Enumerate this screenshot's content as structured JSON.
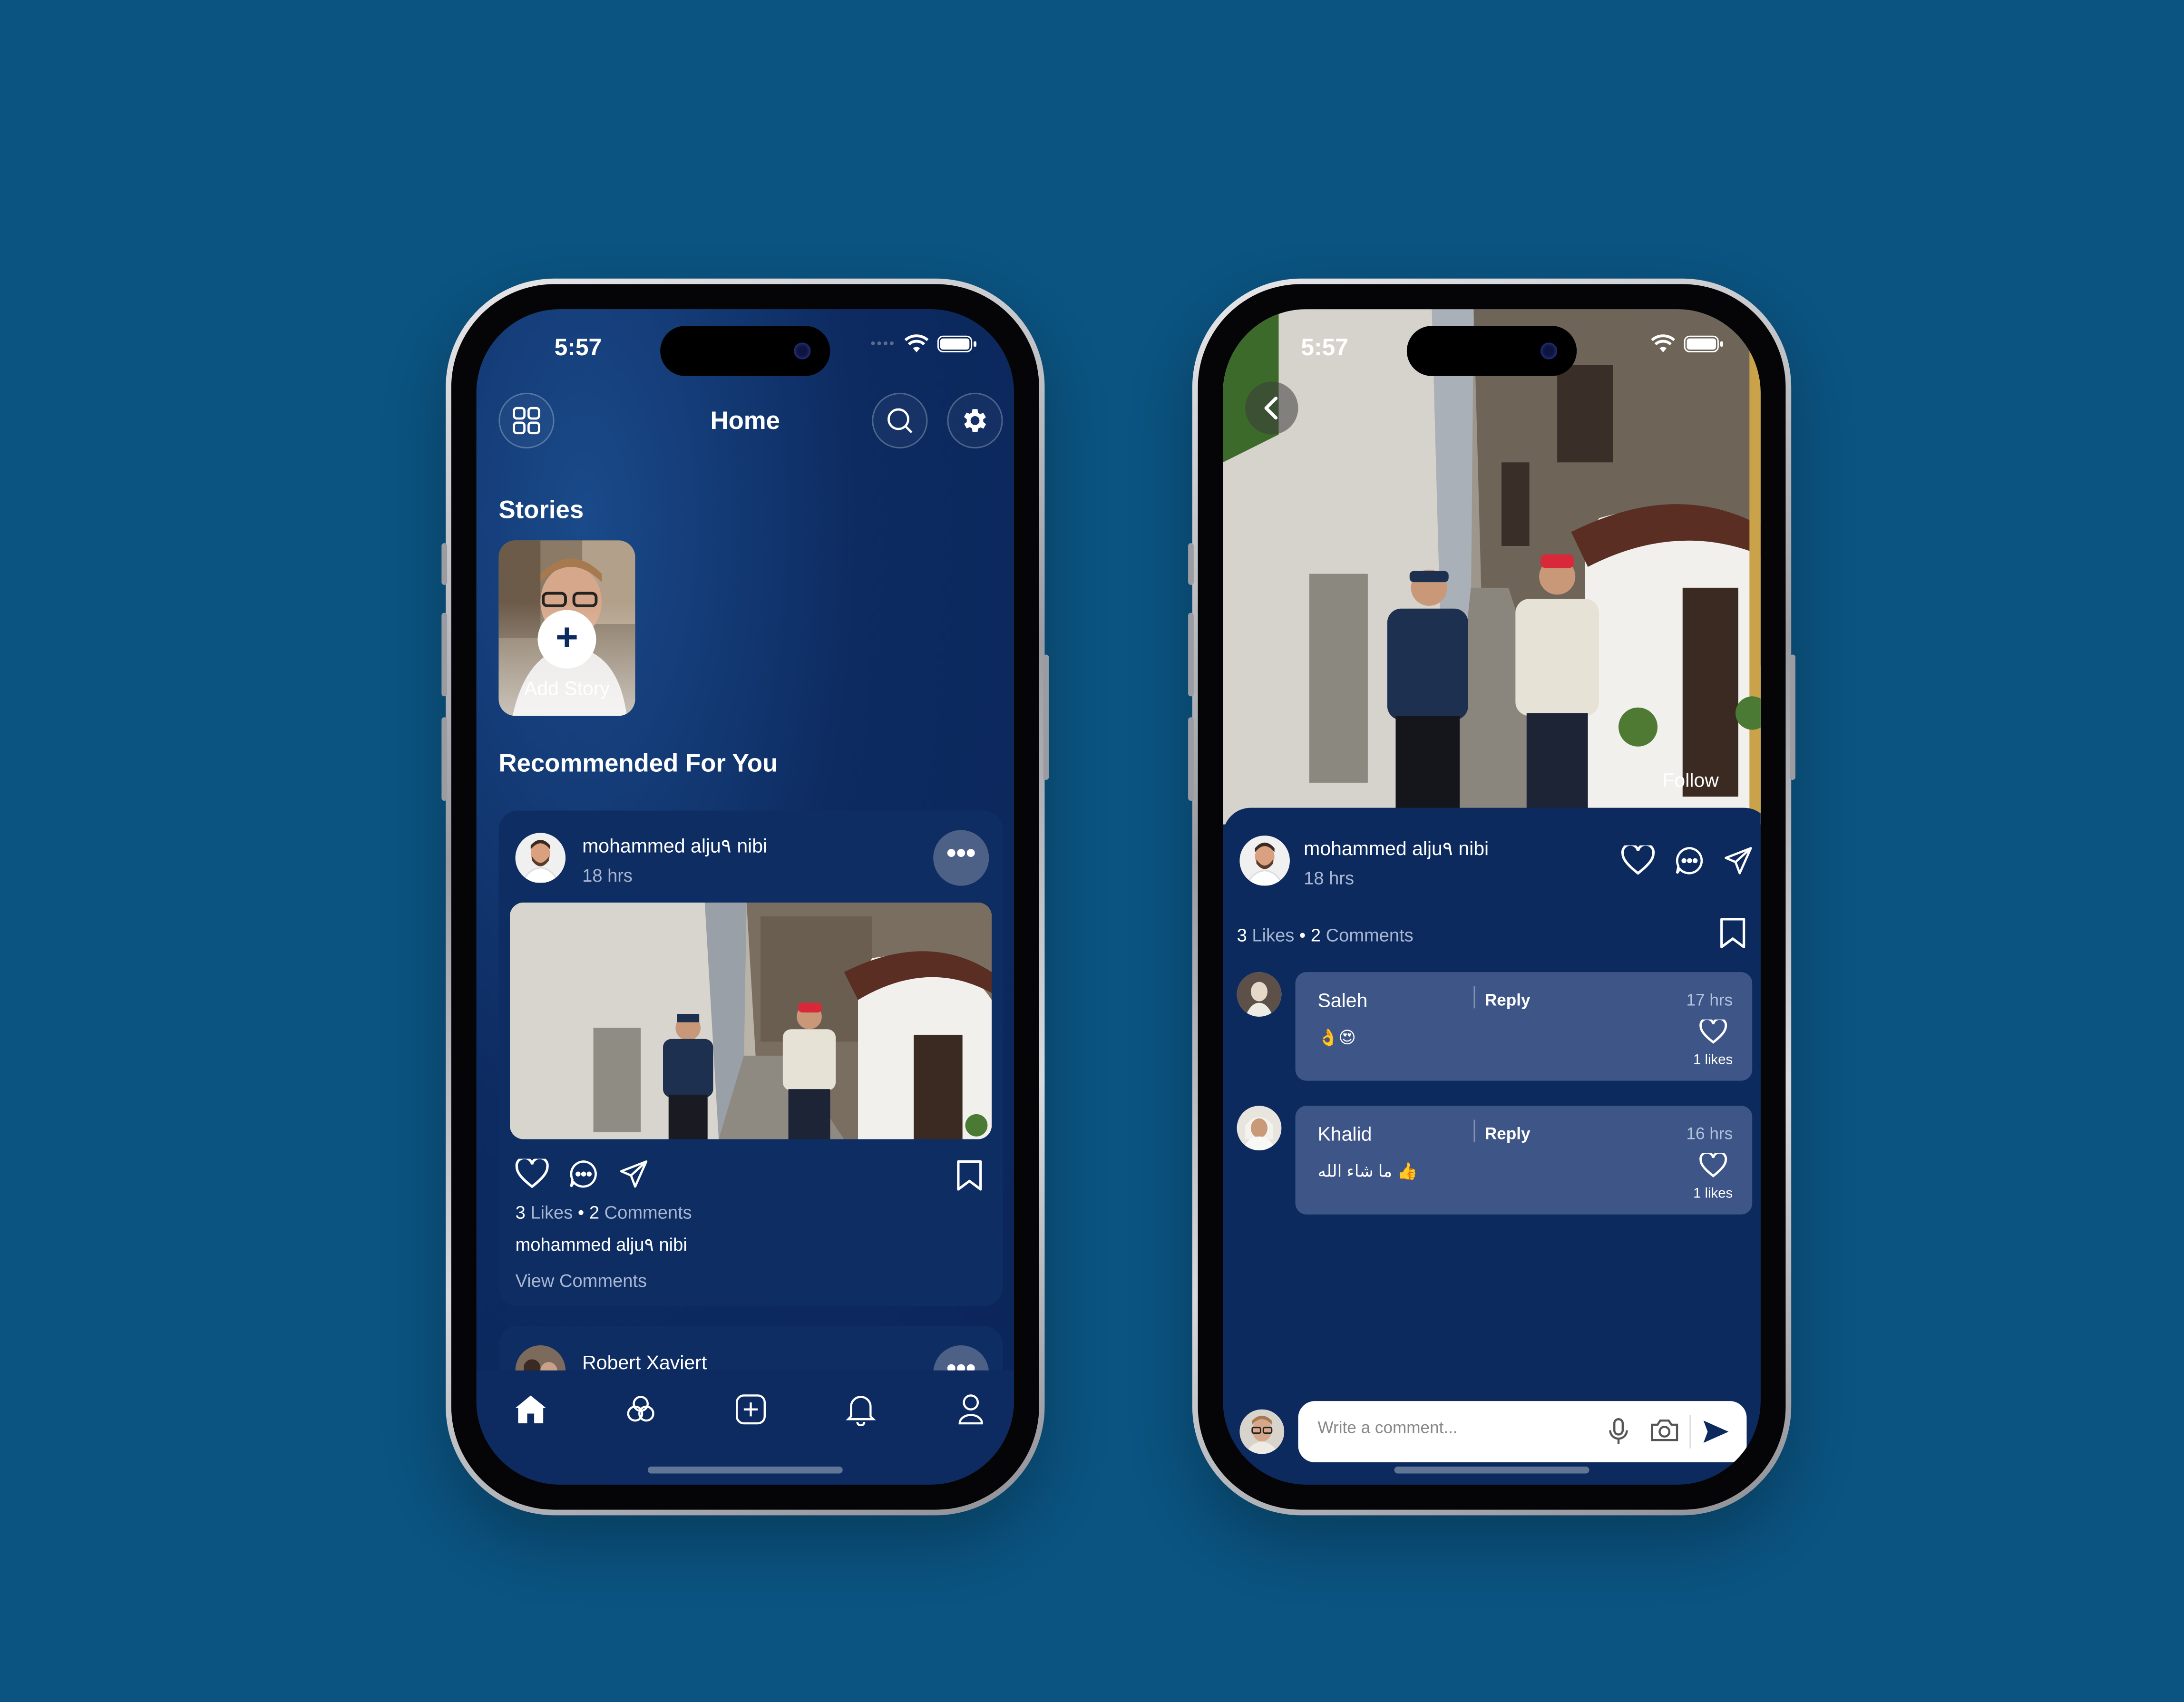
{
  "status": {
    "time": "5:57"
  },
  "home": {
    "title": "Home",
    "stories_title": "Stories",
    "add_story_label": "Add Story",
    "recommended_title": "Recommended For You",
    "post": {
      "username": "mohammed alju٩ nibi",
      "time": "18 hrs",
      "likes_count": "3",
      "likes_label": "Likes",
      "comments_count": "2",
      "comments_label": "Comments",
      "caption_user": "mohammed alju٩ nibi",
      "view_comments": "View Comments"
    },
    "next_post": {
      "username": "Robert Xaviert"
    },
    "icons": {
      "menu": "grid-icon",
      "search": "search-icon",
      "settings": "gear-icon",
      "tabs": [
        "home-icon",
        "community-icon",
        "add-post-icon",
        "bell-icon",
        "profile-icon"
      ]
    }
  },
  "detail": {
    "follow_label": "Follow",
    "post": {
      "username": "mohammed alju٩ nibi",
      "time": "18 hrs",
      "likes_count": "3",
      "likes_label": "Likes",
      "comments_count": "2",
      "comments_label": "Comments"
    },
    "comments": [
      {
        "name": "Saleh",
        "reply_label": "Reply",
        "time": "17 hrs",
        "text": "👌😍",
        "likes": "1 likes"
      },
      {
        "name": "Khalid",
        "reply_label": "Reply",
        "time": "16 hrs",
        "text": "ما شاء الله 👍",
        "likes": "1 likes"
      }
    ],
    "input": {
      "placeholder": "Write a comment..."
    }
  },
  "colors": {
    "background": "#0b5380",
    "app_navy": "#0c2a5e",
    "card": "#0d2d63",
    "comment_bubble": "#3e5687",
    "send_accent": "#0c2a5e"
  }
}
